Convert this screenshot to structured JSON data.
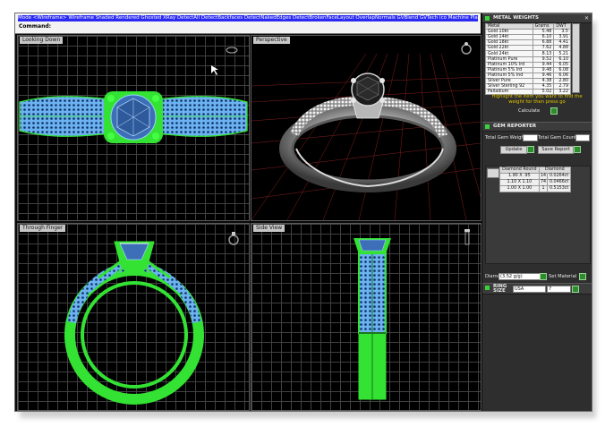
{
  "command": {
    "menu_text": "Mode  <Wireframe>  Wireframe  Shaded  Rendered  Ghosted  XRay  DetectAll  DetectBackfaces  DetectNakedEdges  DetectBrokenFaceLayout  OverlapNormals  GVBlend  GVTech  ico  Machine  Plastic  Presentation",
    "prompt_label": "Command:"
  },
  "viewports": {
    "top": "Looking Down",
    "perspective": "Perspective",
    "front": "Through Finger",
    "side": "Side View"
  },
  "metal_panel": {
    "title": "METAL WEIGHTS",
    "headers": [
      "Metal",
      "Grams",
      "DWT"
    ],
    "rows": [
      [
        "Gold 10kt",
        "5.48",
        "3.5"
      ],
      [
        "Gold 14kt",
        "6.10",
        "3.91"
      ],
      [
        "Gold 18kt",
        "6.88",
        "4.41"
      ],
      [
        "Gold 22kt",
        "7.62",
        "4.88"
      ],
      [
        "Gold 24kt",
        "8.13",
        "5.21"
      ],
      [
        "Platinum Pure",
        "9.52",
        "6.10"
      ],
      [
        "Platinum 10% Ird",
        "9.44",
        "6.05"
      ],
      [
        "Platinum 5% Ird",
        "9.48",
        "6.08"
      ],
      [
        "Platinum 5% Ind",
        "9.46",
        "6.06"
      ],
      [
        "Silver Pure",
        "4.38",
        "2.80"
      ],
      [
        "Silver Sterling 92",
        "4.35",
        "2.79"
      ],
      [
        "Palladium",
        "5.02",
        "3.22"
      ]
    ],
    "hint": "Highlight the item you want to find the weight for then press go",
    "calculate": "Calculate"
  },
  "gem_panel": {
    "title": "GEM REPORTER",
    "total_weight_label": "Total Gem Weight",
    "total_weight_value": "",
    "total_count_label": "Total Gem Count",
    "total_count_value": "",
    "update": "Update",
    "save_report": "Save Report",
    "col_shape": "Diamond Round",
    "col_type": "Diamond",
    "rows": [
      [
        "1.90 X .95",
        "14",
        "0.0264ct"
      ],
      [
        "1.10 X 1.10",
        "74",
        "0.0466ct"
      ],
      [
        "1.00 X 1.00",
        "1",
        "0.5153ct"
      ]
    ],
    "diamond_label": "Diamond",
    "diamond_value": "(3.52 g/g)",
    "set_material": "Set Material"
  },
  "ring_panel": {
    "title": "RING SIZE",
    "region": "USA",
    "size": "7"
  },
  "colors": {
    "wire_green": "#33e233",
    "gem_blue": "#55a6f2",
    "cmd_blue": "#2a2af4",
    "hint_yellow": "#e0c400"
  }
}
